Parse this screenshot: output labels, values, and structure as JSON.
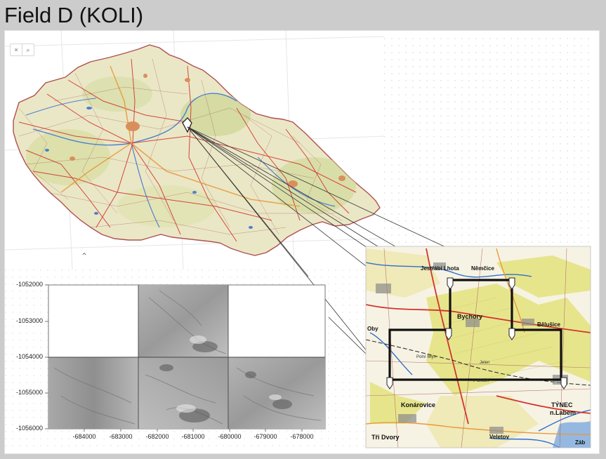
{
  "page": {
    "title": "Field D (KOLI)"
  },
  "map_controls": {
    "close_glyph": "×",
    "search_glyph": "⌕",
    "collapse_glyph": "⌃"
  },
  "elevation_plot": {
    "y_ticks": [
      "-1052000",
      "-1053000",
      "-1054000",
      "-1055000",
      "-1056000"
    ],
    "x_ticks": [
      "-684000",
      "-683000",
      "-682000",
      "-681000",
      "-680000",
      "-679000",
      "-678000"
    ]
  },
  "detail_map": {
    "labels": {
      "jestrabi": "Jestřábí Lhota",
      "nemcice": "Němčice",
      "bychory": "Bychory",
      "belusice": "Bělušice",
      "polni_mlyn": "Polní Mlýn",
      "jelen": "Jelen",
      "konarovice": "Konárovice",
      "tynec": "TÝNEC",
      "tynec2": "n.Labem",
      "tri_dvory": "Tři Dvory",
      "veletov": "Veletov",
      "kolin_edge": "Oby",
      "v_lukach": "V lukách",
      "zabori": "Záb"
    }
  },
  "colors": {
    "boundary": "#111111",
    "road_red": "#d2342e",
    "forest": "#e4e38a",
    "water": "#2f6fd0"
  }
}
